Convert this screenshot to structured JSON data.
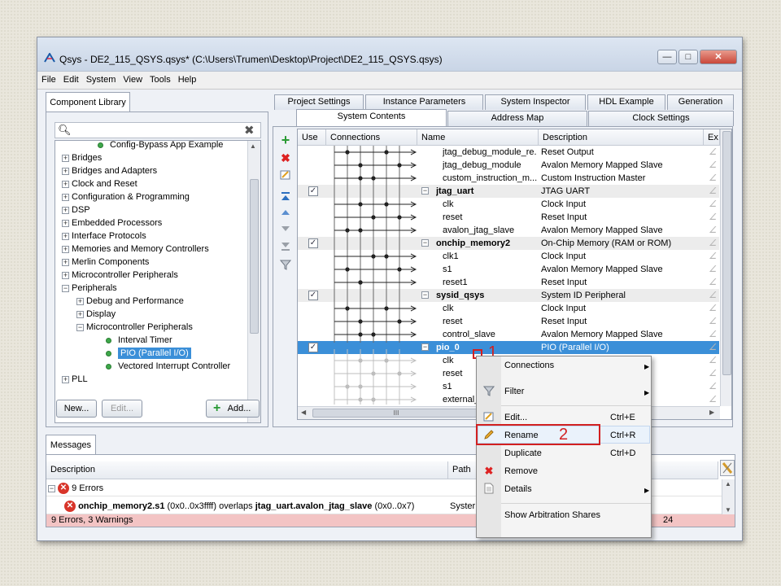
{
  "window": {
    "title": "Qsys - DE2_115_QSYS.qsys* (C:\\Users\\Trumen\\Desktop\\Project\\DE2_115_QSYS.qsys)",
    "minimize": "—",
    "maximize": "□",
    "close": "✕"
  },
  "menu": [
    "File",
    "Edit",
    "System",
    "View",
    "Tools",
    "Help"
  ],
  "library": {
    "tab": "Component Library",
    "search_placeholder": "",
    "items": [
      {
        "label": "Config-Bypass App Example",
        "kind": "leaf",
        "indent": 1
      },
      {
        "label": "Bridges",
        "kind": "plus",
        "indent": 0
      },
      {
        "label": "Bridges and Adapters",
        "kind": "plus",
        "indent": 0
      },
      {
        "label": "Clock and Reset",
        "kind": "plus",
        "indent": 0
      },
      {
        "label": "Configuration & Programming",
        "kind": "plus",
        "indent": 0
      },
      {
        "label": "DSP",
        "kind": "plus",
        "indent": 0
      },
      {
        "label": "Embedded Processors",
        "kind": "plus",
        "indent": 0
      },
      {
        "label": "Interface Protocols",
        "kind": "plus",
        "indent": 0
      },
      {
        "label": "Memories and Memory Controllers",
        "kind": "plus",
        "indent": 0
      },
      {
        "label": "Merlin Components",
        "kind": "plus",
        "indent": 0
      },
      {
        "label": "Microcontroller Peripherals",
        "kind": "plus",
        "indent": 0
      },
      {
        "label": "Peripherals",
        "kind": "minus",
        "indent": 0
      },
      {
        "label": "Debug and Performance",
        "kind": "plus",
        "indent": 1
      },
      {
        "label": "Display",
        "kind": "plus",
        "indent": 1
      },
      {
        "label": "Microcontroller Peripherals",
        "kind": "minus",
        "indent": 1
      },
      {
        "label": "Interval Timer",
        "kind": "leaf",
        "indent": 2
      },
      {
        "label": "PIO (Parallel I/O)",
        "kind": "leaf",
        "indent": 2,
        "selected": true
      },
      {
        "label": "Vectored Interrupt Controller",
        "kind": "leaf",
        "indent": 2
      },
      {
        "label": "PLL",
        "kind": "plus",
        "indent": 0
      }
    ],
    "new_button": "New...",
    "edit_button": "Edit...",
    "add_button": "Add..."
  },
  "top_tabs": [
    "Project Settings",
    "Instance Parameters",
    "System Inspector",
    "HDL Example",
    "Generation"
  ],
  "second_tabs": [
    "System Contents",
    "Address Map",
    "Clock Settings"
  ],
  "grid": {
    "headers": {
      "use": "Use",
      "connections": "Connections",
      "name": "Name",
      "description": "Description",
      "export": "Ex"
    },
    "rows": [
      {
        "name": "jtag_debug_module_re...",
        "desc": "Reset Output",
        "type": "child"
      },
      {
        "name": "jtag_debug_module",
        "desc": "Avalon Memory Mapped Slave",
        "type": "child"
      },
      {
        "name": "custom_instruction_m...",
        "desc": "Custom Instruction Master",
        "type": "child"
      },
      {
        "name": "jtag_uart",
        "desc": "JTAG UART",
        "type": "group",
        "checked": true
      },
      {
        "name": "clk",
        "desc": "Clock Input",
        "type": "child"
      },
      {
        "name": "reset",
        "desc": "Reset Input",
        "type": "child"
      },
      {
        "name": "avalon_jtag_slave",
        "desc": "Avalon Memory Mapped Slave",
        "type": "child"
      },
      {
        "name": "onchip_memory2",
        "desc": "On-Chip Memory (RAM or ROM)",
        "type": "group",
        "checked": true
      },
      {
        "name": "clk1",
        "desc": "Clock Input",
        "type": "child"
      },
      {
        "name": "s1",
        "desc": "Avalon Memory Mapped Slave",
        "type": "child"
      },
      {
        "name": "reset1",
        "desc": "Reset Input",
        "type": "child"
      },
      {
        "name": "sysid_qsys",
        "desc": "System ID Peripheral",
        "type": "group",
        "checked": true
      },
      {
        "name": "clk",
        "desc": "Clock Input",
        "type": "child"
      },
      {
        "name": "reset",
        "desc": "Reset Input",
        "type": "child"
      },
      {
        "name": "control_slave",
        "desc": "Avalon Memory Mapped Slave",
        "type": "child"
      },
      {
        "name": "pio_0",
        "desc": "PIO (Parallel I/O)",
        "type": "group",
        "checked": true,
        "selected": true
      },
      {
        "name": "clk",
        "desc": "",
        "type": "child"
      },
      {
        "name": "reset",
        "desc": "",
        "type": "child"
      },
      {
        "name": "s1",
        "desc": "ve",
        "type": "child"
      },
      {
        "name": "external_",
        "desc": "",
        "type": "child"
      }
    ],
    "hscroll_mark": "III"
  },
  "messages": {
    "tab": "Messages",
    "col_description": "Description",
    "col_path": "Path",
    "errors_group": "9 Errors",
    "error_line_prefix": "onchip_memory2.s1",
    "error_line_mid": " (0x0..0x3ffff) overlaps ",
    "error_line_bold": "jtag_uart.avalon_jtag_slave",
    "error_line_end": " (0x0..0x7)",
    "error_path": "Syster",
    "status": "9 Errors, 3 Warnings",
    "status_right": "24"
  },
  "context_menu": {
    "items": [
      {
        "label": "Connections",
        "submenu": true
      },
      {
        "label": "Filter",
        "submenu": true
      },
      {
        "label": "Edit...",
        "shortcut": "Ctrl+E"
      },
      {
        "label": "Rename",
        "shortcut": "Ctrl+R"
      },
      {
        "label": "Duplicate",
        "shortcut": "Ctrl+D"
      },
      {
        "label": "Remove"
      },
      {
        "label": "Details",
        "submenu": true
      },
      {
        "label": "Show Arbitration Shares"
      }
    ]
  },
  "annotations": {
    "step1": "1",
    "step2": "2"
  },
  "colors": {
    "selection": "#3b8fd8",
    "annotation": "#d22020",
    "error": "#d8352a"
  }
}
